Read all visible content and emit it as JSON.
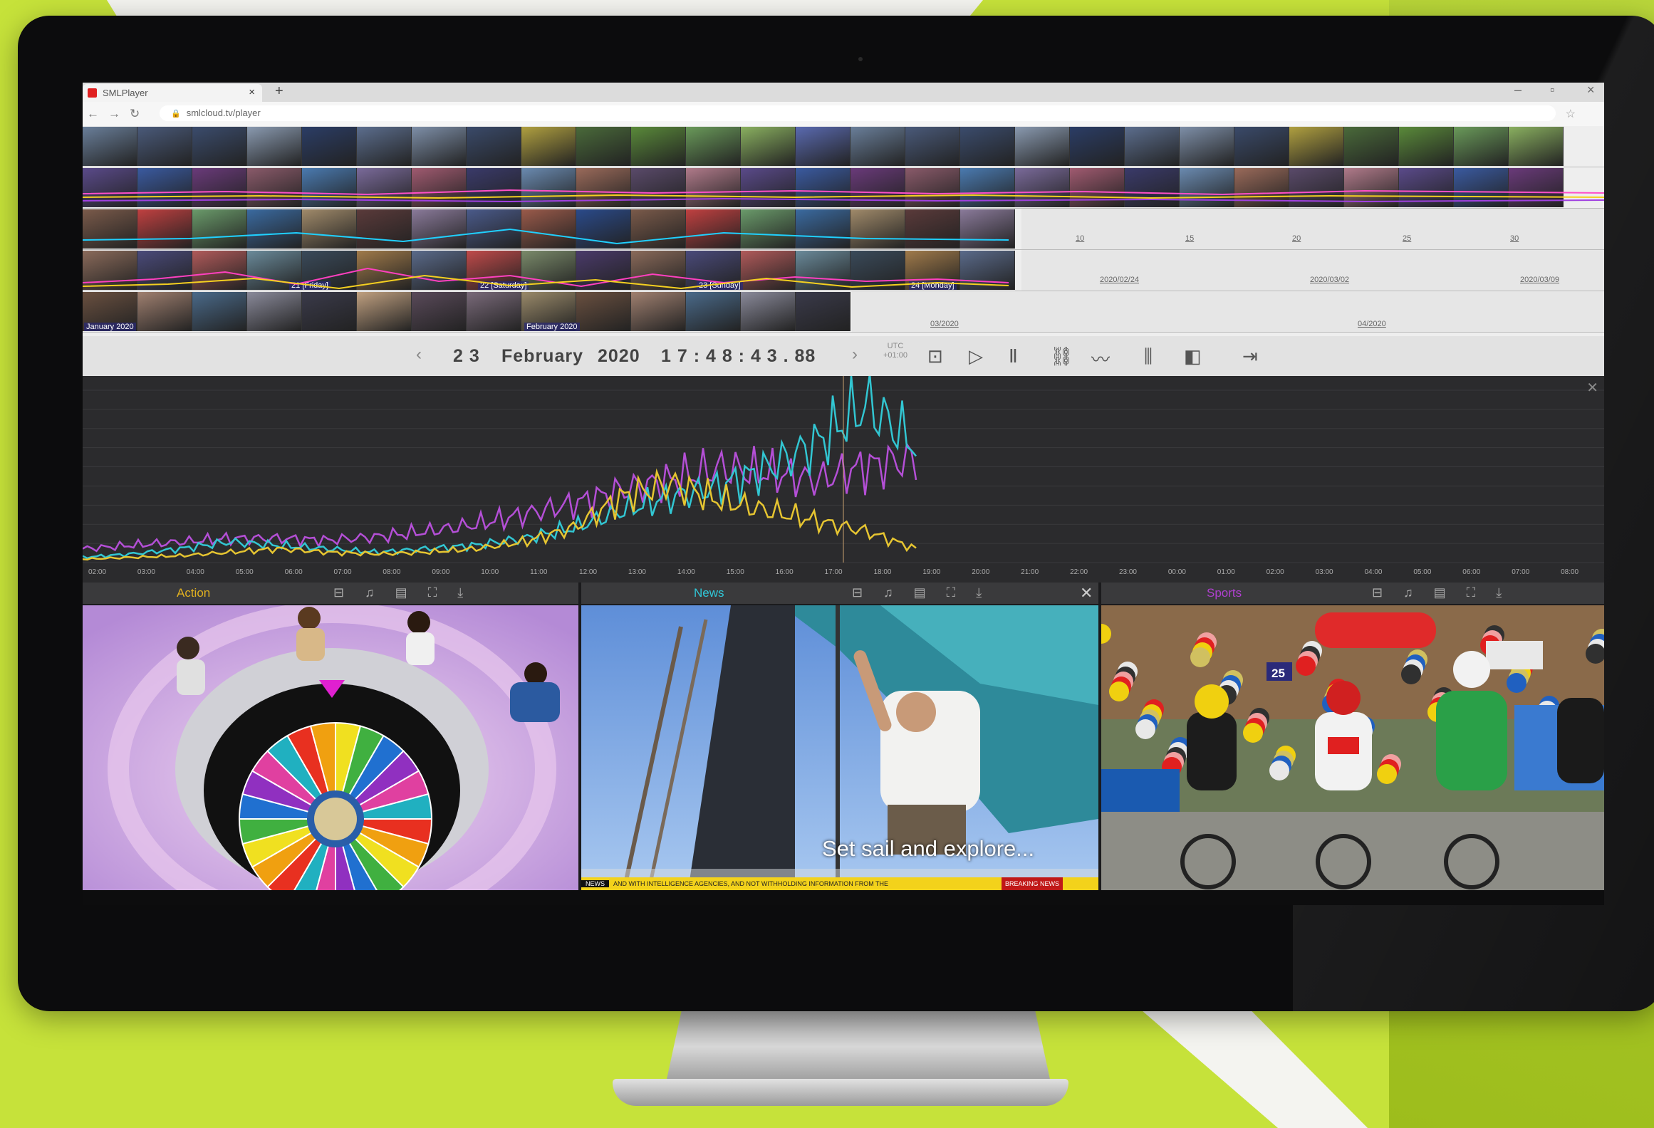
{
  "browser": {
    "tab_title": "SMLPlayer",
    "url": "smlcloud.tv/player",
    "new_tab": "+",
    "tab_close": "×"
  },
  "timeline": {
    "tick_labels": [
      "10",
      "15",
      "20",
      "25",
      "30"
    ],
    "week_labels": [
      "2020/02/24",
      "2020/03/02",
      "2020/03/09"
    ],
    "month_labels": [
      "03/2020",
      "04/2020"
    ],
    "date_markers": [
      "January 2020",
      "February 2020",
      "21 [Friday]",
      "22 [Saturday]",
      "23 [Sunday]",
      "24 [Monday]"
    ]
  },
  "controls": {
    "prev": "‹",
    "day": "2 3",
    "month": "February",
    "year": "2020",
    "time": "1 7 : 4 8 : 4 3 . 88",
    "next": "›",
    "utc_line1": "UTC",
    "utc_line2": "+01:00"
  },
  "chart_data": {
    "type": "line",
    "x": [
      "02:00",
      "03:00",
      "04:00",
      "05:00",
      "06:00",
      "07:00",
      "08:00",
      "09:00",
      "10:00",
      "11:00",
      "12:00",
      "13:00",
      "14:00",
      "15:00",
      "16:00",
      "17:00",
      "18:00",
      "19:00",
      "20:00",
      "21:00",
      "22:00",
      "23:00",
      "00:00",
      "01:00",
      "02:00",
      "03:00",
      "04:00",
      "05:00",
      "06:00",
      "07:00",
      "08:00"
    ],
    "series": [
      {
        "color": "#b44fd6",
        "values": [
          8,
          10,
          12,
          14,
          14,
          13,
          15,
          18,
          22,
          28,
          34,
          42,
          48,
          55,
          52,
          48,
          56,
          60
        ]
      },
      {
        "color": "#32c6d2",
        "values": [
          3,
          5,
          8,
          12,
          10,
          8,
          6,
          8,
          10,
          14,
          20,
          30,
          38,
          44,
          55,
          70,
          92,
          68
        ]
      },
      {
        "color": "#e6c531",
        "values": [
          2,
          3,
          4,
          6,
          8,
          6,
          5,
          6,
          8,
          12,
          20,
          38,
          46,
          36,
          30,
          24,
          18,
          8
        ]
      }
    ],
    "xlim_shown": [
      "02:00",
      "08:00"
    ],
    "grid": true
  },
  "panels": [
    {
      "title": "Action",
      "color": "#e0b020"
    },
    {
      "title": "News",
      "color": "#30c8d8"
    },
    {
      "title": "Sports",
      "color": "#b040d0"
    }
  ],
  "videos": {
    "news_caption": "Set sail and explore...",
    "news_ticker_label": "NEWS",
    "news_ticker": "AND WITH INTELLIGENCE AGENCIES, AND NOT WITHHOLDING INFORMATION FROM THE",
    "news_ticker_right": "BREAKING NEWS",
    "sports_bib": "25"
  },
  "icons": {
    "panel_header": "⊟ ♫ ▤ ⛶ ⤓",
    "close": "✕"
  }
}
